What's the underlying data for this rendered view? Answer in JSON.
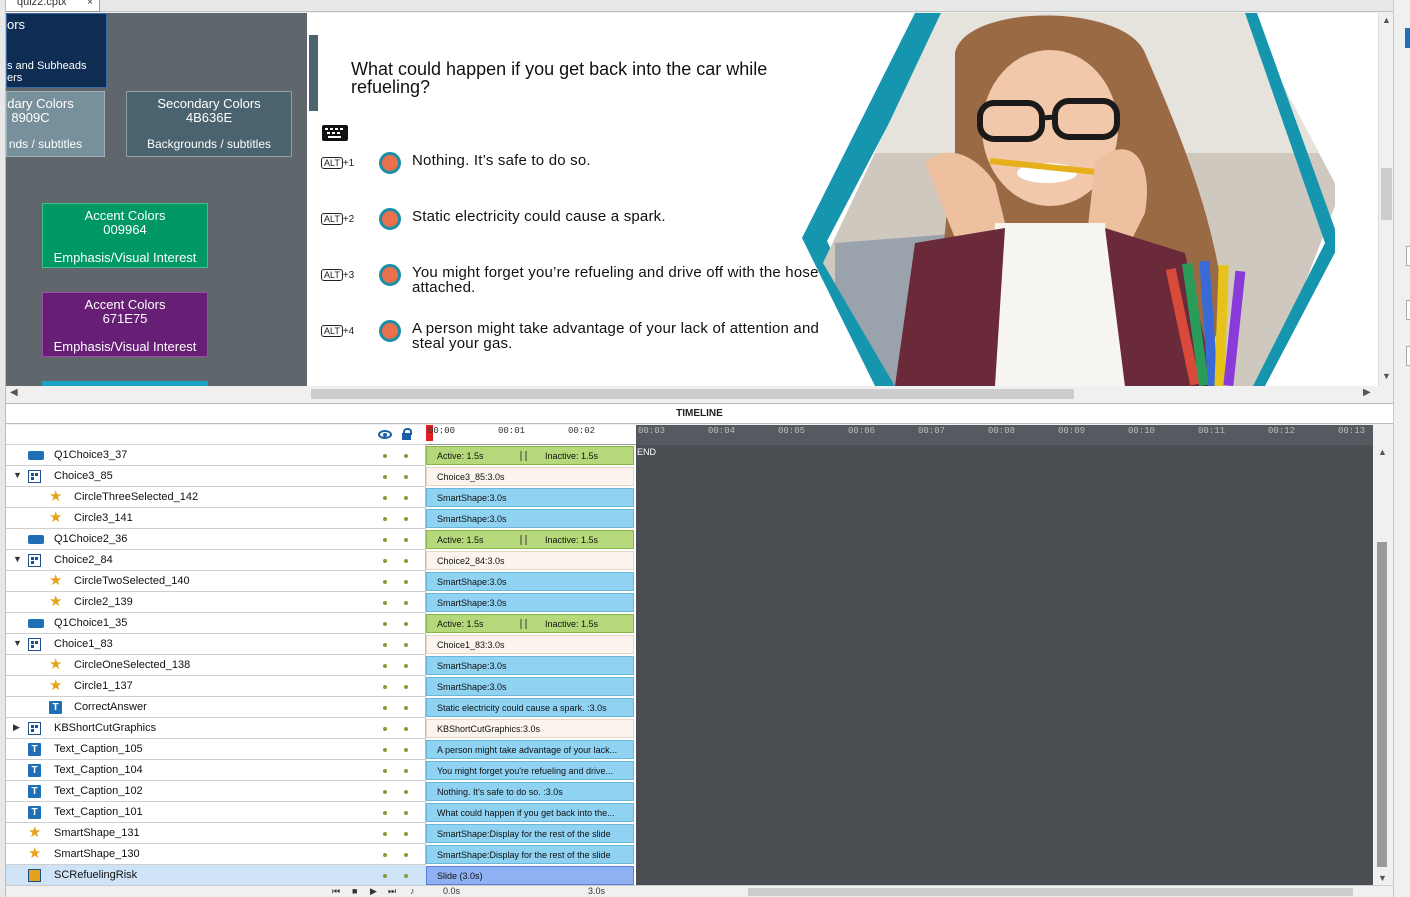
{
  "window": {
    "tab_label": "quiz2.cptx",
    "tab_close": "×"
  },
  "swatches": {
    "navy": {
      "line1": "ors",
      "line2": "s and Subheads",
      "line3": "ers"
    },
    "gray1": {
      "name": "dary Colors",
      "hex": "8909C",
      "desc": "nds / subtitles"
    },
    "gray2": {
      "name": "Secondary Colors",
      "hex": "4B636E",
      "desc": "Backgrounds / subtitles"
    },
    "green": {
      "name": "Accent Colors",
      "hex": "009964",
      "desc": "Emphasis/Visual Interest"
    },
    "purple": {
      "name": "Accent Colors",
      "hex": "671E75",
      "desc": "Emphasis/Visual Interest"
    }
  },
  "slide": {
    "question": "What could happen if you get back into the car while refueling?",
    "choices": [
      {
        "alt": "ALT",
        "key": "+1",
        "text": "Nothing. It’s safe to do so."
      },
      {
        "alt": "ALT",
        "key": "+2",
        "text": "Static electricity could cause a spark."
      },
      {
        "alt": "ALT",
        "key": "+3",
        "text": "You might forget you’re refueling and drive off with the hose attached."
      },
      {
        "alt": "ALT",
        "key": "+4",
        "text": "A person might take advantage of your lack of attention and steal your gas."
      }
    ]
  },
  "timeline": {
    "title": "TIMELINE",
    "ruler": [
      "00:00",
      "00:01",
      "00:02",
      "00:03",
      "00:04",
      "00:05",
      "00:06",
      "00:07",
      "00:08",
      "00:09",
      "00:10",
      "00:11",
      "00:12",
      "00:13"
    ],
    "end_label": "END",
    "rows": [
      {
        "name": "Q1Choice3_37",
        "icon": "rect",
        "indent": 0,
        "expander": "",
        "bar": "green",
        "active": "Active: 1.5s",
        "inactive": "Inactive: 1.5s"
      },
      {
        "name": "Choice3_85",
        "icon": "group",
        "indent": 0,
        "expander": "▼",
        "bar": "beige",
        "label": "Choice3_85:3.0s"
      },
      {
        "name": "CircleThreeSelected_142",
        "icon": "star",
        "indent": 1,
        "expander": "",
        "bar": "blue",
        "label": "SmartShape:3.0s"
      },
      {
        "name": "Circle3_141",
        "icon": "star",
        "indent": 1,
        "expander": "",
        "bar": "blue",
        "label": "SmartShape:3.0s"
      },
      {
        "name": "Q1Choice2_36",
        "icon": "rect",
        "indent": 0,
        "expander": "",
        "bar": "green",
        "active": "Active: 1.5s",
        "inactive": "Inactive: 1.5s"
      },
      {
        "name": "Choice2_84",
        "icon": "group",
        "indent": 0,
        "expander": "▼",
        "bar": "beige",
        "label": "Choice2_84:3.0s"
      },
      {
        "name": "CircleTwoSelected_140",
        "icon": "star",
        "indent": 1,
        "expander": "",
        "bar": "blue",
        "label": "SmartShape:3.0s"
      },
      {
        "name": "Circle2_139",
        "icon": "star",
        "indent": 1,
        "expander": "",
        "bar": "blue",
        "label": "SmartShape:3.0s"
      },
      {
        "name": "Q1Choice1_35",
        "icon": "rect",
        "indent": 0,
        "expander": "",
        "bar": "green",
        "active": "Active: 1.5s",
        "inactive": "Inactive: 1.5s"
      },
      {
        "name": "Choice1_83",
        "icon": "group",
        "indent": 0,
        "expander": "▼",
        "bar": "beige",
        "label": "Choice1_83:3.0s"
      },
      {
        "name": "CircleOneSelected_138",
        "icon": "star",
        "indent": 1,
        "expander": "",
        "bar": "blue",
        "label": "SmartShape:3.0s"
      },
      {
        "name": "Circle1_137",
        "icon": "star",
        "indent": 1,
        "expander": "",
        "bar": "blue",
        "label": "SmartShape:3.0s"
      },
      {
        "name": "CorrectAnswer",
        "icon": "text",
        "indent": 1,
        "expander": "",
        "bar": "blue",
        "label": "Static electricity could cause a spark. :3.0s"
      },
      {
        "name": "KBShortCutGraphics",
        "icon": "group",
        "indent": 0,
        "expander": "▶",
        "bar": "beige",
        "label": "KBShortCutGraphics:3.0s"
      },
      {
        "name": "Text_Caption_105",
        "icon": "text",
        "indent": 0,
        "expander": "",
        "bar": "blue",
        "label": "A person might take advantage of your lack..."
      },
      {
        "name": "Text_Caption_104",
        "icon": "text",
        "indent": 0,
        "expander": "",
        "bar": "blue",
        "label": "You might forget you're refueling and drive..."
      },
      {
        "name": "Text_Caption_102",
        "icon": "text",
        "indent": 0,
        "expander": "",
        "bar": "blue",
        "label": "Nothing. It's safe to do so.  :3.0s"
      },
      {
        "name": "Text_Caption_101",
        "icon": "text",
        "indent": 0,
        "expander": "",
        "bar": "blue",
        "label": "What could happen if you get back into the..."
      },
      {
        "name": "SmartShape_131",
        "icon": "star",
        "indent": 0,
        "expander": "",
        "bar": "blue",
        "label": "SmartShape:Display for the rest of the slide"
      },
      {
        "name": "SmartShape_130",
        "icon": "star",
        "indent": 0,
        "expander": "",
        "bar": "blue",
        "label": "SmartShape:Display for the rest of the slide"
      },
      {
        "name": "SCRefuelingRisk",
        "icon": "slide",
        "indent": 0,
        "expander": "",
        "bar": "slide",
        "label": "Slide (3.0s)",
        "selected": true
      }
    ],
    "footer": {
      "time_now": "0.0s",
      "time_total": "3.0s"
    }
  }
}
